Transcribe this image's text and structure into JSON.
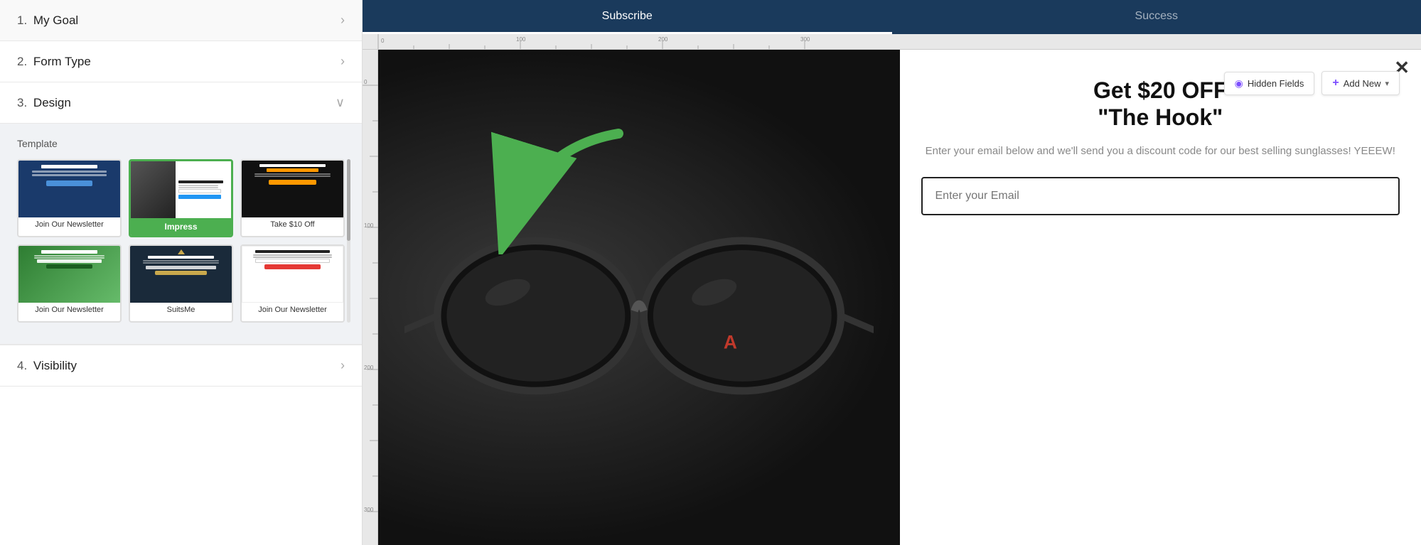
{
  "sidebar": {
    "items": [
      {
        "id": "my-goal",
        "number": "1.",
        "label": "My Goal"
      },
      {
        "id": "form-type",
        "number": "2.",
        "label": "Form Type"
      },
      {
        "id": "design",
        "number": "3.",
        "label": "Design",
        "expanded": true
      },
      {
        "id": "visibility",
        "number": "4.",
        "label": "Visibility"
      }
    ],
    "design": {
      "template_label": "Template",
      "templates": [
        {
          "id": "newsletter-1",
          "name": "Join Our Newsletter",
          "selected": false
        },
        {
          "id": "impress",
          "name": "Impress",
          "selected": true
        },
        {
          "id": "watch",
          "name": "Take $10 Off",
          "selected": false
        },
        {
          "id": "green-nl",
          "name": "Join Our Newsletter",
          "selected": false
        },
        {
          "id": "suitsme",
          "name": "SuitsMe",
          "selected": false
        },
        {
          "id": "newsletter-3",
          "name": "Join Our Newsletter",
          "selected": false
        }
      ]
    }
  },
  "tabs": [
    {
      "id": "subscribe",
      "label": "Subscribe",
      "active": true
    },
    {
      "id": "success",
      "label": "Success",
      "active": false
    }
  ],
  "toolbar": {
    "hidden_fields_label": "Hidden Fields",
    "add_new_label": "Add New"
  },
  "popup": {
    "close_label": "✕",
    "title_line1": "Get $20 OFF",
    "title_line2": "\"The Hook\"",
    "description": "Enter your email below and we'll send you a discount code for our best selling sunglasses! YEEEW!",
    "email_placeholder": "Enter your Email"
  },
  "ruler": {
    "top_ticks": [
      "0",
      "100",
      "200",
      "300"
    ],
    "left_ticks": [
      "0",
      "100",
      "200",
      "300"
    ]
  },
  "colors": {
    "tab_bg": "#1a3a5c",
    "accent_green": "#4caf50",
    "accent_purple": "#7c4dff",
    "sidebar_bg": "#ffffff",
    "canvas_bg": "#888888"
  }
}
